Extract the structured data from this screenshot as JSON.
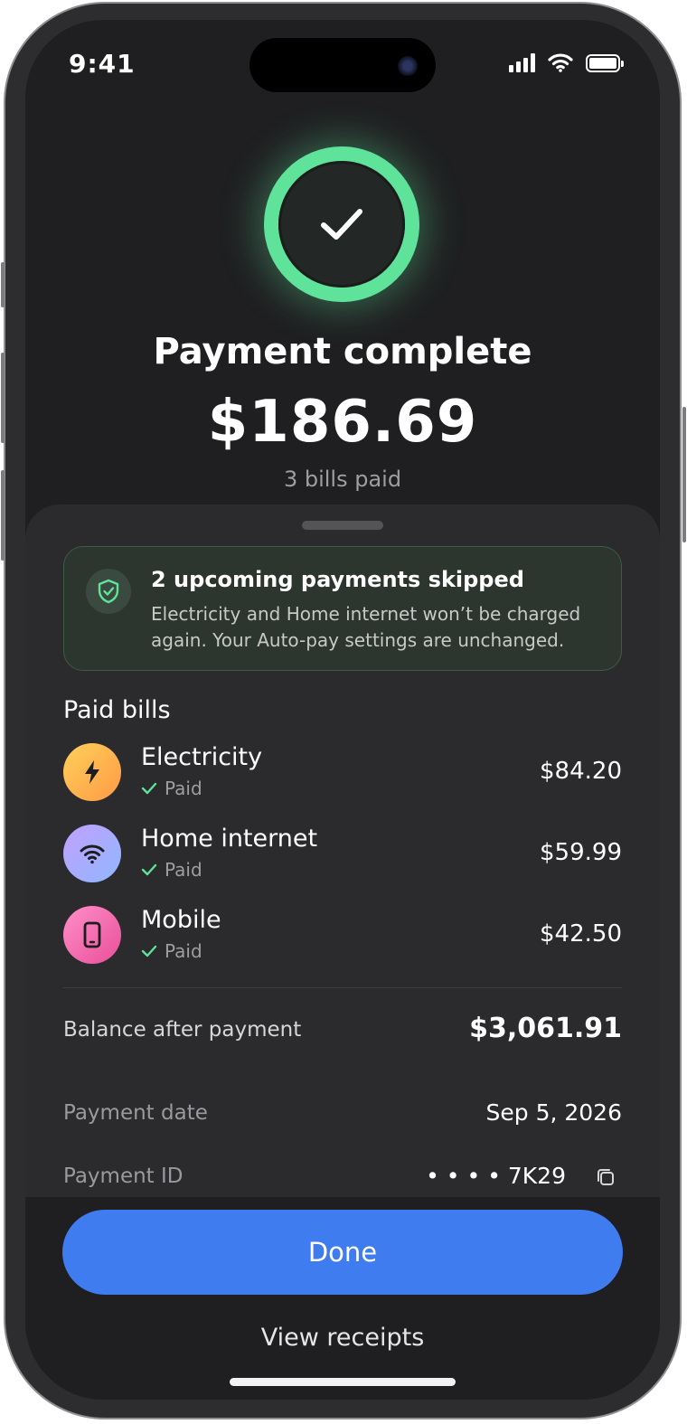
{
  "status_bar": {
    "time": "9:41"
  },
  "success": {
    "title": "Payment complete",
    "amount": "$186.69",
    "subtitle": "3 bills paid",
    "accent": "#5fe39a"
  },
  "notice": {
    "icon": "shield-check-icon",
    "title": "2 upcoming payments skipped",
    "body": "Electricity and Home internet won’t be charged again. Your Auto-pay settings are unchanged."
  },
  "paid_bills": {
    "title": "Paid bills",
    "items": [
      {
        "name": "Electricity",
        "status": "Paid",
        "amount": "$84.20",
        "icon": "lightning-icon"
      },
      {
        "name": "Home internet",
        "status": "Paid",
        "amount": "$59.99",
        "icon": "wifi-icon"
      },
      {
        "name": "Mobile",
        "status": "Paid",
        "amount": "$42.50",
        "icon": "phone-icon"
      }
    ]
  },
  "details": {
    "balance_label": "Balance after payment",
    "balance_value": "$3,061.91",
    "date_label": "Payment date",
    "date_value": "Sep 5, 2026",
    "id_label": "Payment ID",
    "id_value": "• • • • 7K29"
  },
  "actions": {
    "done_label": "Done",
    "receipts_label": "View receipts",
    "primary_color": "#3f7cf0"
  }
}
